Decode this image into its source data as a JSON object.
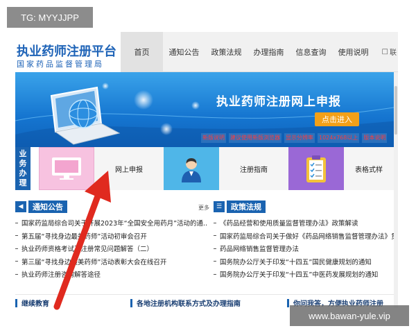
{
  "header": {
    "logo_title": "执业药师注册平台",
    "logo_subtitle": "国家药品监督管理局"
  },
  "nav": {
    "items": [
      "首页",
      "通知公告",
      "政策法规",
      "办理指南",
      "信息查询",
      "使用说明"
    ],
    "extra": "联",
    "active_index": 0
  },
  "banner": {
    "title": "执业药师注册网上申报",
    "button": "点击进入",
    "notices": [
      "新版说明",
      "建议使用新版浏览器",
      "显示分辨率",
      "1024x768以上",
      "版本说明"
    ]
  },
  "business": {
    "label": [
      "业",
      "务",
      "办",
      "理"
    ],
    "tiles": [
      {
        "icon": "monitor-icon",
        "label": "网上申报",
        "color": "#f3b8dc"
      },
      {
        "icon": "person-icon",
        "label": "注册指南",
        "color": "#4fb6e8"
      },
      {
        "icon": "clipboard-icon",
        "label": "表格式样",
        "color": "#9a68d6"
      }
    ]
  },
  "notices": {
    "title": "通知公告",
    "more": "更多",
    "items": [
      "国家药监局综合司关于开展2023年“全国安全用药月”活动的通...",
      "第五届“寻找身边最美药师”活动初审会召开",
      "执业药师资格考试及注册常见问题解答（二）",
      "第三届“寻找身边最美药师”活动表彰大会在线召开",
      "执业药师注册咨询解答途径"
    ]
  },
  "policies": {
    "title": "政策法规",
    "items": [
      "《药品经营和使用质量监督管理办法》政策解读",
      "国家药监局综合司关于做好《药品网络销售监督管理办法》贯彻落",
      "药品网络销售监督管理办法",
      "国务院办公厅关于印发“十四五”国民健康规划的通知",
      "国务院办公厅关于印发“十四五”中医药发展规划的通知"
    ]
  },
  "bottom": {
    "left": "继续教育",
    "middle": "各地注册机构联系方式及办理指南",
    "right": "你问我答，方便执业药师注册"
  },
  "watermarks": {
    "top": "TG: MYYJJPP",
    "bottom": "www.bawan-yule.vip"
  },
  "colors": {
    "brand_blue": "#1a63b0",
    "banner_blue": "#1575d0",
    "button_orange": "#f3a018",
    "arrow_red": "#e02a1f",
    "notice_red": "#ff3b3b"
  }
}
